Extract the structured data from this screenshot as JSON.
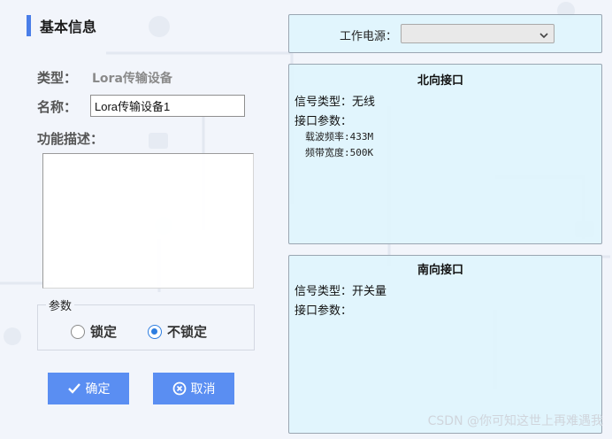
{
  "basic_info": {
    "title": "基本信息",
    "type_label": "类型：",
    "type_value": "Lora传输设备",
    "name_label": "名称：",
    "name_value": "Lora传输设备1",
    "desc_label": "功能描述：",
    "desc_value": "",
    "params": {
      "legend": "参数",
      "options": [
        "锁定",
        "不锁定"
      ],
      "selected": "不锁定"
    }
  },
  "buttons": {
    "confirm": "确定",
    "cancel": "取消"
  },
  "power": {
    "label": "工作电源：",
    "value": ""
  },
  "north": {
    "title": "北向接口",
    "signal_type": "信号类型：无线",
    "params_label": "接口参数：",
    "params": [
      "载波频率:433M",
      "频带宽度:500K"
    ]
  },
  "south": {
    "title": "南向接口",
    "signal_type": "信号类型：开关量",
    "params_label": "接口参数："
  },
  "colors": {
    "accent": "#5a8ef2",
    "title_bar": "#4a7ee8",
    "panel_bg": "#e0f4fd",
    "radio_checked": "#2d7de0"
  },
  "watermark": "CSDN @你可知这世上再难遇我"
}
